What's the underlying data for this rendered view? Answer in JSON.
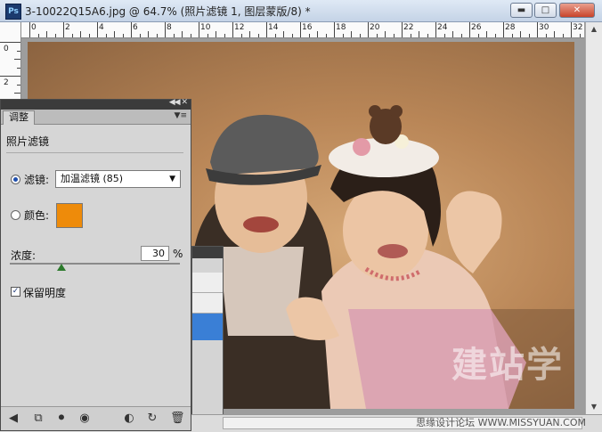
{
  "window": {
    "app_icon": "Ps",
    "title": "3-10022Q15A6.jpg @ 64.7% (照片滤镜 1, 图层蒙版/8) *"
  },
  "ruler": {
    "h_labels": [
      "0",
      "2",
      "4",
      "6",
      "8",
      "10",
      "12",
      "14",
      "16",
      "18",
      "20",
      "22",
      "24",
      "26",
      "28",
      "30",
      "32"
    ],
    "v_labels": [
      "0",
      "2"
    ]
  },
  "adjustments": {
    "tab_label": "调整",
    "heading": "照片滤镜",
    "filter_label": "滤镜:",
    "filter_value": "加温滤镜 (85)",
    "color_label": "颜色:",
    "color_value": "#ee8b0a",
    "density_label": "浓度:",
    "density_value": "30",
    "density_unit": "%",
    "density_level": 0.3,
    "preserve_label": "保留明度",
    "preserve_checked": true
  },
  "watermark": {
    "big_text": "建站学",
    "small_text": "思缘设计论坛 WWW.MISSYUAN.COM"
  },
  "colors": {
    "accent": "#ee8b0a",
    "selection": "#3a7fd6"
  }
}
